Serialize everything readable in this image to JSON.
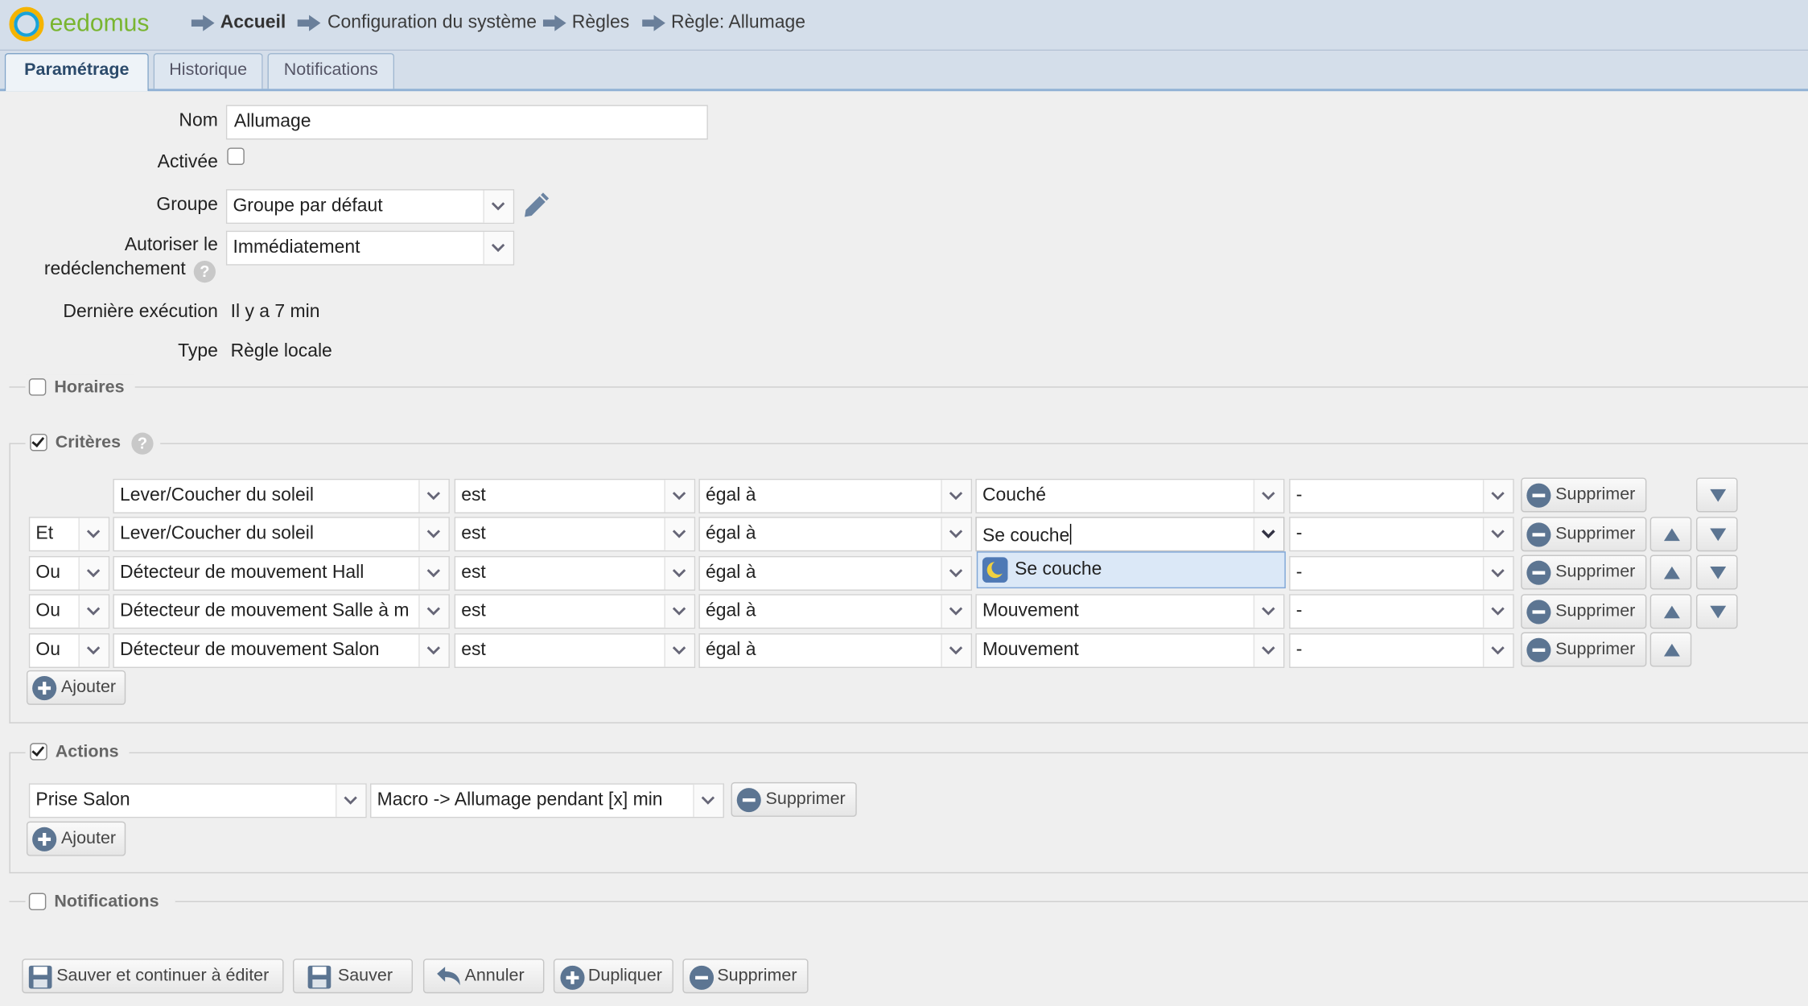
{
  "app": {
    "logo_text": "eedomus"
  },
  "breadcrumb": [
    "Accueil",
    "Configuration du système",
    "Règles",
    "Règle: Allumage"
  ],
  "tabs": [
    "Paramétrage",
    "Historique",
    "Notifications"
  ],
  "form": {
    "nom_label": "Nom",
    "nom_value": "Allumage",
    "activee_label": "Activée",
    "activee_checked": false,
    "groupe_label": "Groupe",
    "groupe_value": "Groupe par défaut",
    "autoriser_label_1": "Autoriser le",
    "autoriser_label_2": "redéclenchement",
    "autoriser_value": "Immédiatement",
    "help_glyph": "?",
    "derniere_label": "Dernière exécution",
    "derniere_value": "Il y a 7 min",
    "type_label": "Type",
    "type_value": "Règle locale"
  },
  "sections": {
    "horaires": {
      "label": "Horaires",
      "checked": false
    },
    "criteres": {
      "label": "Critères",
      "checked": true
    },
    "actions": {
      "label": "Actions",
      "checked": true
    },
    "notifications": {
      "label": "Notifications",
      "checked": false
    }
  },
  "criteria_rows": [
    {
      "logic": "",
      "device": "Lever/Coucher du soleil",
      "op1": "est",
      "op2": "égal à",
      "value": "Couché",
      "extra": "-",
      "delete": "Supprimer"
    },
    {
      "logic": "Et",
      "device": "Lever/Coucher du soleil",
      "op1": "est",
      "op2": "égal à",
      "value": "Se couche",
      "extra": "-",
      "delete": "Supprimer"
    },
    {
      "logic": "Ou",
      "device": "Détecteur de mouvement Hall",
      "op1": "est",
      "op2": "égal à",
      "value": "",
      "extra": "-",
      "delete": "Supprimer"
    },
    {
      "logic": "Ou",
      "device": "Détecteur de mouvement Salle à m",
      "op1": "est",
      "op2": "égal à",
      "value": "Mouvement",
      "extra": "-",
      "delete": "Supprimer"
    },
    {
      "logic": "Ou",
      "device": "Détecteur de mouvement Salon",
      "op1": "est",
      "op2": "égal à",
      "value": "Mouvement",
      "extra": "-",
      "delete": "Supprimer"
    }
  ],
  "autocomplete": {
    "option": "Se couche"
  },
  "criteria_add": "Ajouter",
  "action_row": {
    "device": "Prise Salon",
    "action": "Macro -> Allumage pendant [x] min",
    "delete": "Supprimer"
  },
  "actions_add": "Ajouter",
  "footer_buttons": {
    "save_continue": "Sauver et continuer à éditer",
    "save": "Sauver",
    "cancel": "Annuler",
    "duplicate": "Dupliquer",
    "delete": "Supprimer"
  },
  "colors": {
    "header_bg": "#d4deea",
    "logo_green": "#79b530",
    "button_icon": "#5c7592"
  }
}
